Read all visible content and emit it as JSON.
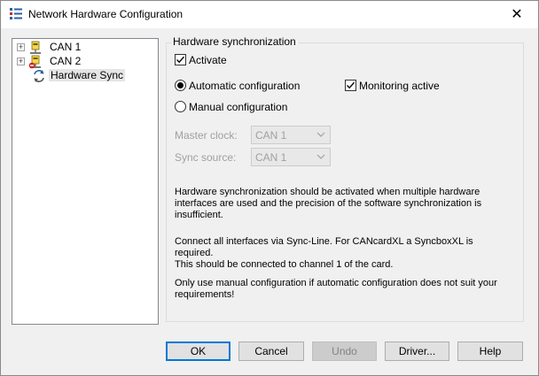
{
  "window": {
    "title": "Network Hardware Configuration",
    "close_label": "✕"
  },
  "tree": {
    "items": [
      {
        "label": "CAN 1",
        "expander": "+"
      },
      {
        "label": "CAN 2",
        "expander": "+"
      },
      {
        "label": "Hardware Sync"
      }
    ]
  },
  "group": {
    "title": "Hardware synchronization",
    "activate_label": "Activate",
    "activate_checked": true,
    "auto_config_label": "Automatic configuration",
    "manual_config_label": "Manual configuration",
    "selected_mode": "automatic",
    "monitoring_label": "Monitoring active",
    "monitoring_checked": true,
    "master_clock_label": "Master clock:",
    "master_clock_value": "CAN 1",
    "sync_source_label": "Sync source:",
    "sync_source_value": "CAN 1",
    "para1_line1": "Hardware synchronization should be activated when multiple hardware",
    "para1_line2": "interfaces are used and the precision of the software synchronization is",
    "para1_line3": "insufficient.",
    "para2_line1": "Connect all interfaces via Sync-Line. For CANcardXL a SyncboxXL is required.",
    "para2_line2": "This should be connected to channel 1 of the card.",
    "para3_line1": "Only use manual configuration if automatic configuration does not suit your",
    "para3_line2": "requirements!"
  },
  "buttons": {
    "ok": "OK",
    "cancel": "Cancel",
    "undo": "Undo",
    "driver": "Driver...",
    "help": "Help"
  },
  "colors": {
    "accent": "#0078d7",
    "disabled_text": "#a0a0a0"
  }
}
